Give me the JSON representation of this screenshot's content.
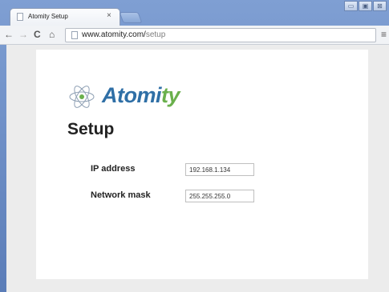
{
  "browser": {
    "tab": {
      "title": "Atomity Setup",
      "close_glyph": "×",
      "favicon": "page-icon"
    },
    "window_controls": {
      "minimize": "▭",
      "maximize": "▣",
      "close": "⊠"
    },
    "toolbar": {
      "back_glyph": "←",
      "forward_glyph": "→",
      "reload_glyph": "C",
      "home_glyph": "⌂",
      "url_host": "www.atomity.com/",
      "url_path": "setup",
      "menu_glyph": "≡"
    }
  },
  "page": {
    "logo": {
      "text_main": "Atomi",
      "text_accent": "ty",
      "icon": "atom-icon",
      "color": "#2f6fa6",
      "accent_color": "#6ab04c"
    },
    "title": "Setup",
    "form": {
      "ip_label": "IP address",
      "ip_value": "192.168.1.134",
      "mask_label": "Network mask",
      "mask_value": "255.255.255.0"
    }
  }
}
